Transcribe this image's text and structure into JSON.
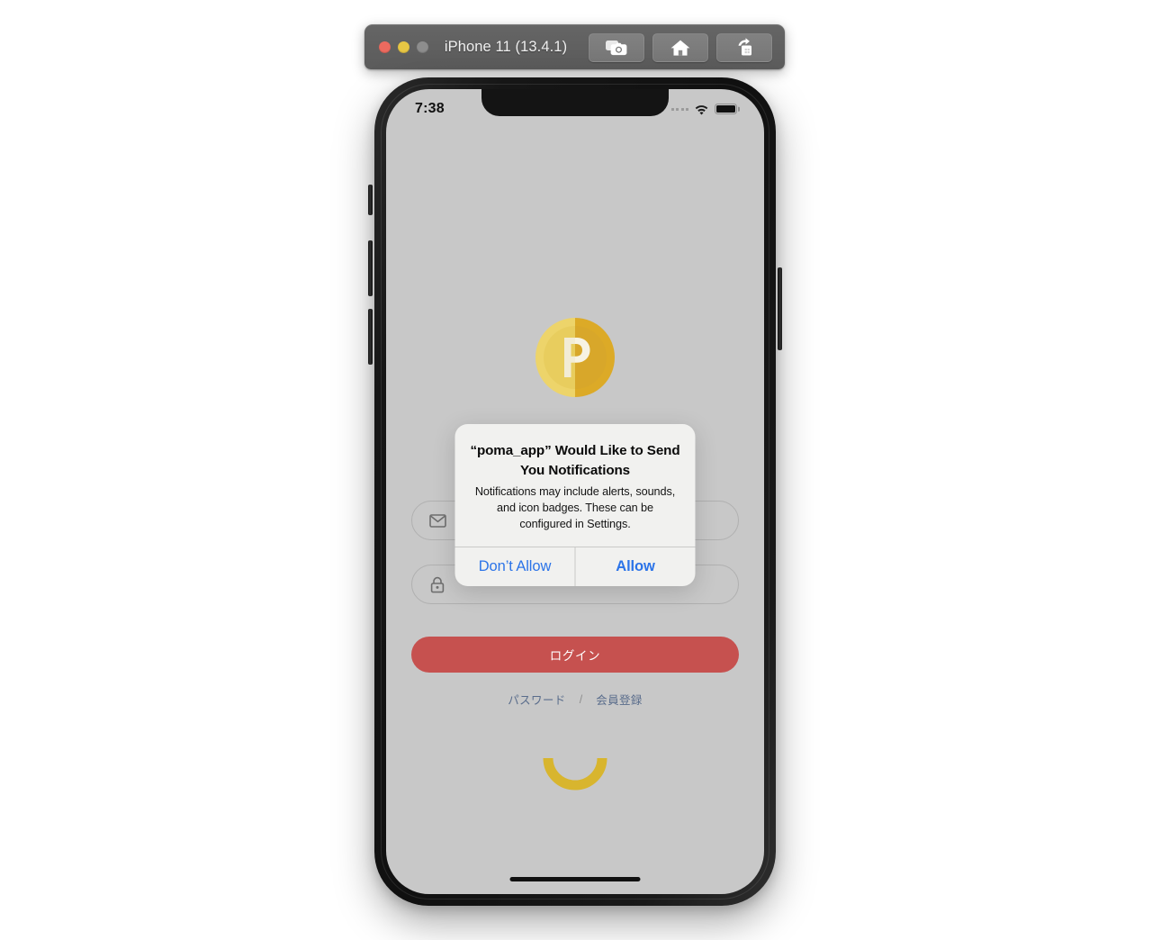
{
  "simulator_window": {
    "title": "iPhone 11 (13.4.1)",
    "traffic_lights": [
      {
        "name": "close",
        "color": "#ec6a5f"
      },
      {
        "name": "minimize",
        "color": "#e7c644"
      },
      {
        "name": "zoom",
        "color": "#8d8d8d"
      }
    ],
    "toolbar_buttons": [
      {
        "icon": "screenshot-camera-icon",
        "label": "Screenshot"
      },
      {
        "icon": "home-icon",
        "label": "Home"
      },
      {
        "icon": "rotate-icon",
        "label": "Rotate"
      }
    ]
  },
  "status_bar": {
    "time": "7:38",
    "signal_icon": "signal-dots-icon",
    "wifi_icon": "wifi-icon",
    "battery_icon": "battery-full-icon"
  },
  "app": {
    "logo": {
      "icon": "coin-logo-icon",
      "letter": "P",
      "color_light": "#edd46a",
      "color_dark": "#d9a827"
    },
    "email_field": {
      "icon": "envelope-icon",
      "value": "",
      "placeholder": ""
    },
    "password_field": {
      "icon": "lock-icon",
      "value": "",
      "placeholder": ""
    },
    "login_button": {
      "label": "ログイン",
      "color": "#c6514f"
    },
    "links": {
      "password": "パスワード",
      "separator": "/",
      "register": "会員登録",
      "color": "#5a6d8c"
    },
    "spinner": {
      "icon": "loading-spinner-icon",
      "color": "#d8b52e"
    },
    "home_indicator": "home-indicator"
  },
  "alert": {
    "title": "“poma_app” Would Like to Send You Notifications",
    "message": "Notifications may include alerts, sounds, and icon badges. These can be configured in Settings.",
    "deny_label": "Don’t Allow",
    "allow_label": "Allow",
    "action_color": "#2c74e8"
  }
}
